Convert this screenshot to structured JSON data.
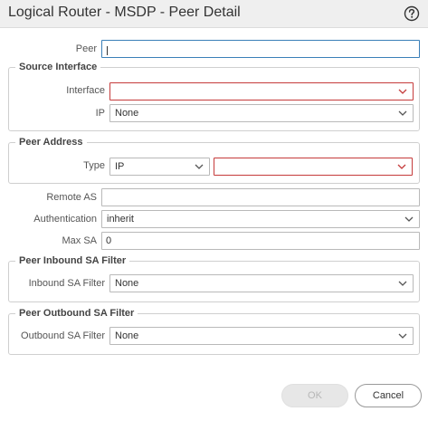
{
  "dialog": {
    "title": "Logical Router - MSDP - Peer Detail",
    "help_icon": "question-circle-icon"
  },
  "peer": {
    "label": "Peer",
    "value": ""
  },
  "source_interface": {
    "legend": "Source Interface",
    "interface": {
      "label": "Interface",
      "value": ""
    },
    "ip": {
      "label": "IP",
      "value": "None"
    }
  },
  "peer_address": {
    "legend": "Peer Address",
    "type": {
      "label": "Type",
      "value": "IP"
    },
    "address": {
      "value": ""
    }
  },
  "remote_as": {
    "label": "Remote AS",
    "value": ""
  },
  "authentication": {
    "label": "Authentication",
    "value": "inherit"
  },
  "max_sa": {
    "label": "Max SA",
    "value": "0"
  },
  "peer_inbound": {
    "legend": "Peer Inbound SA Filter",
    "filter": {
      "label": "Inbound SA Filter",
      "value": "None"
    }
  },
  "peer_outbound": {
    "legend": "Peer Outbound SA Filter",
    "filter": {
      "label": "Outbound SA Filter",
      "value": "None"
    }
  },
  "buttons": {
    "ok": "OK",
    "cancel": "Cancel"
  },
  "colors": {
    "error": "#c53b3b",
    "focus": "#3a7fb8",
    "disabled_text": "#b6b6b6"
  }
}
